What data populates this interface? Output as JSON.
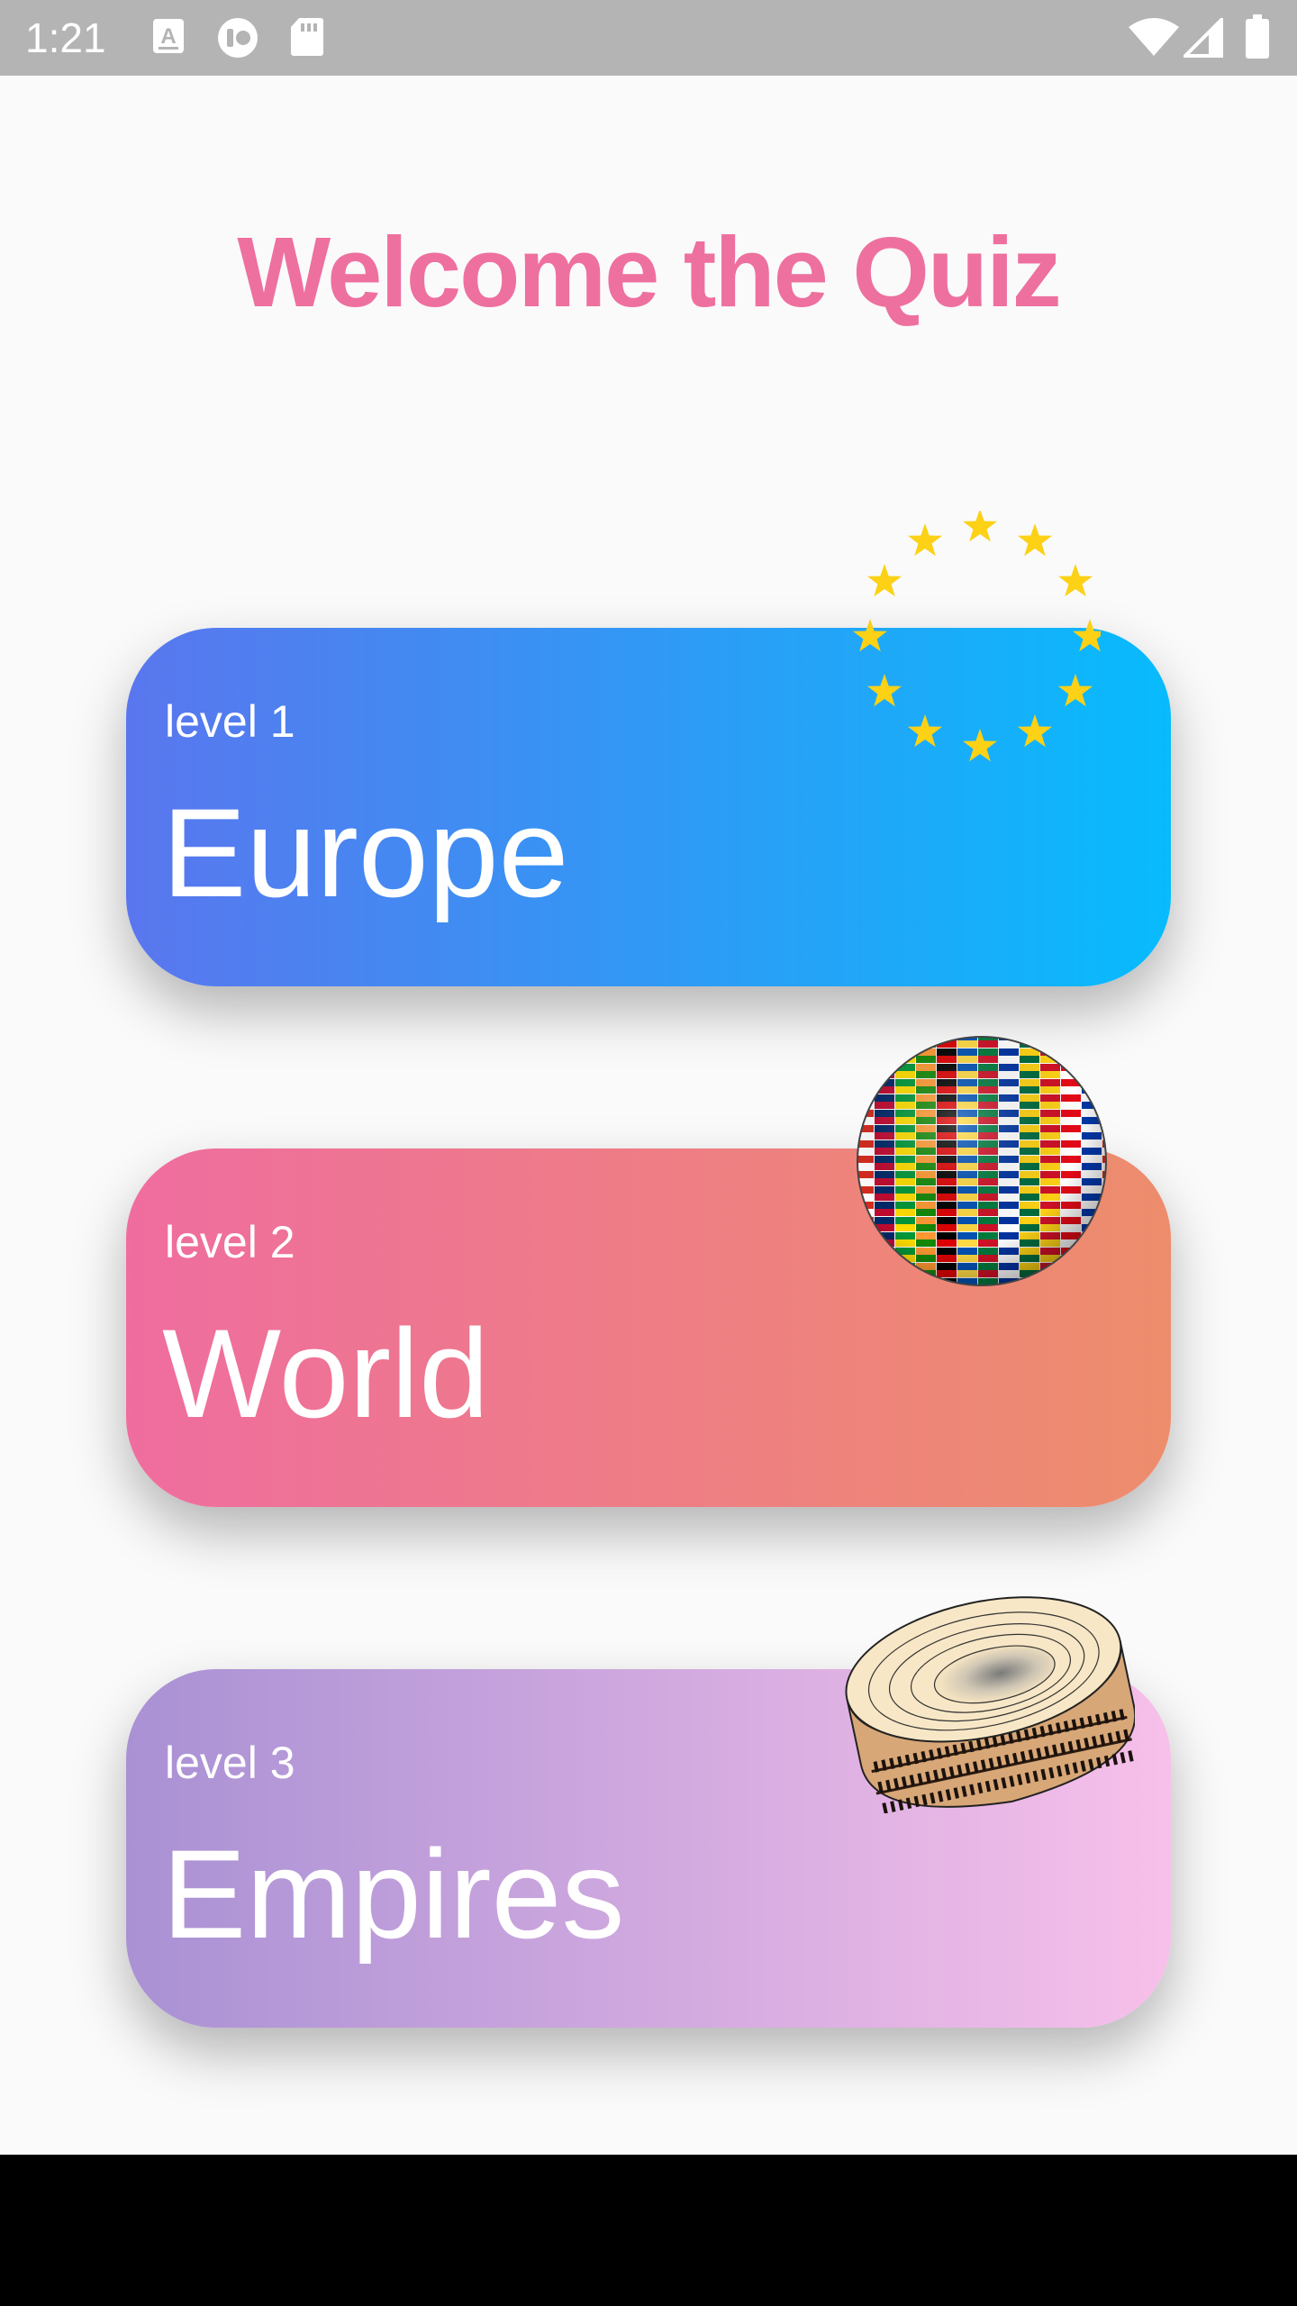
{
  "status_bar": {
    "time": "1:21",
    "left_icons": [
      "keyboard-a-icon",
      "switch-access-icon",
      "sd-card-icon"
    ],
    "right_icons": [
      "wifi-icon",
      "cell-signal-icon",
      "battery-icon"
    ]
  },
  "title": "Welcome the Quiz",
  "levels": [
    {
      "level": "level 1",
      "name": "Europe",
      "art": "eu-stars-icon",
      "gradient": [
        "#5a76ee",
        "#08bbfc"
      ]
    },
    {
      "level": "level 2",
      "name": "World",
      "art": "flag-globe-icon",
      "gradient": [
        "#ef6d9f",
        "#ed8d6c"
      ]
    },
    {
      "level": "level 3",
      "name": "Empires",
      "art": "colosseum-icon",
      "gradient": [
        "#a991d4",
        "#f7c0ea"
      ]
    }
  ]
}
